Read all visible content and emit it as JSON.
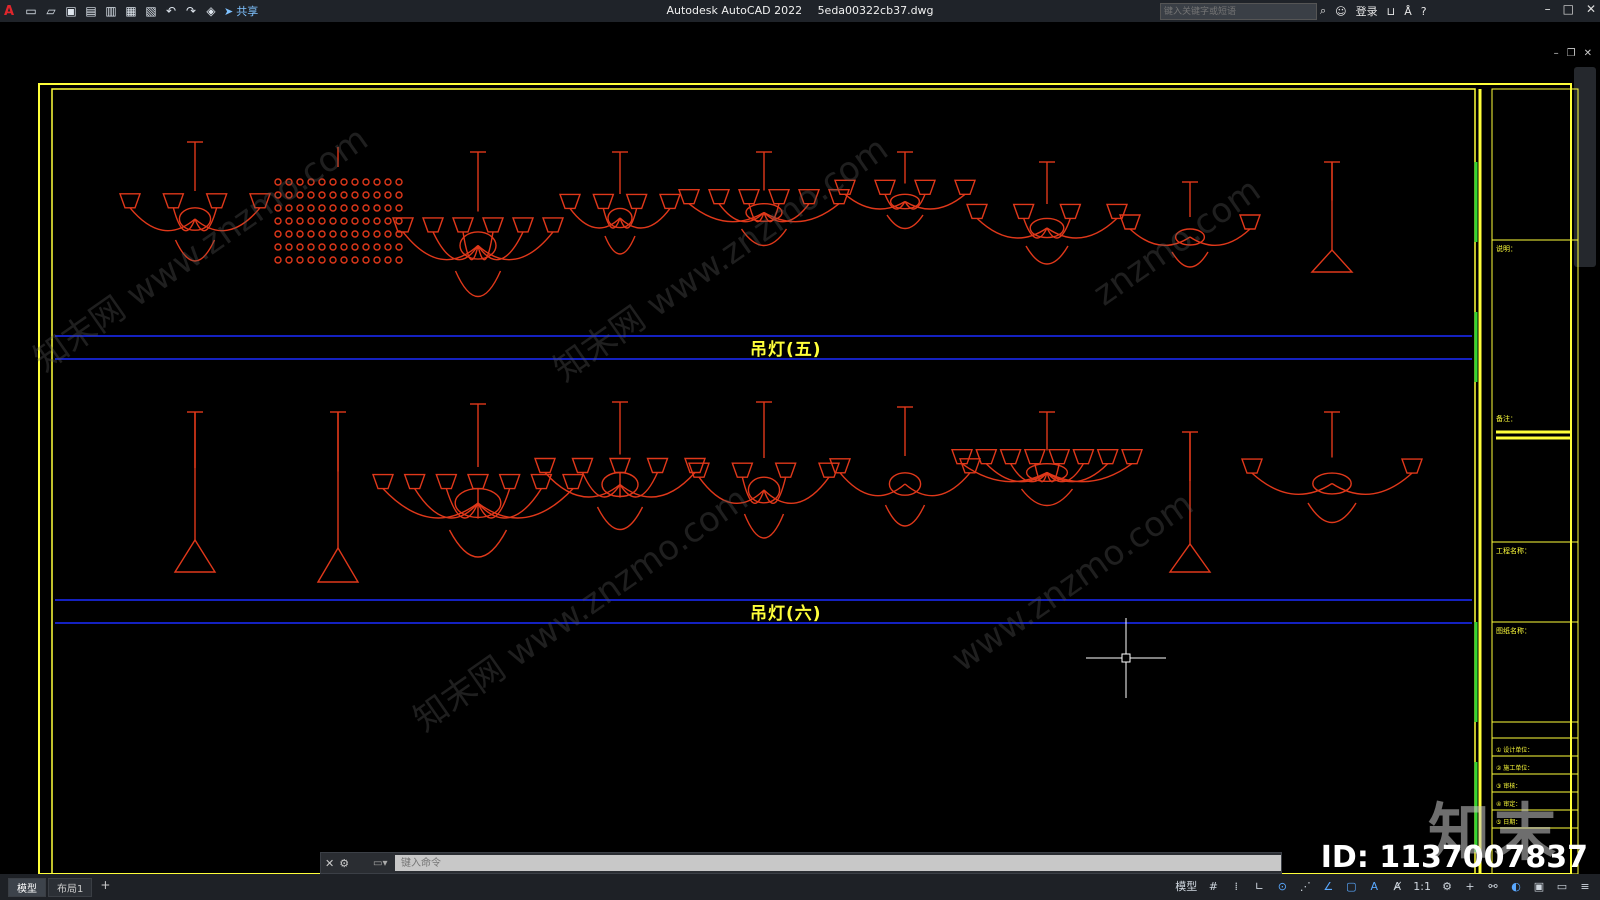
{
  "app": {
    "title": "Autodesk AutoCAD 2022",
    "filename": "5eda00322cb37.dwg",
    "logo": "A"
  },
  "quick_access": {
    "share_label": "共享",
    "icons": [
      "new-icon",
      "open-icon",
      "save-icon",
      "saveas-icon",
      "open-web-icon",
      "save-web-icon",
      "plot-icon",
      "undo-icon",
      "redo-icon",
      "workspace-icon",
      "share-icon"
    ]
  },
  "search": {
    "placeholder": "键入关键字或短语"
  },
  "account": {
    "login_label": "登录"
  },
  "drawing": {
    "row1_title": "吊灯(五)",
    "row2_title": "吊灯(六)",
    "colors": {
      "fixtures": "#e0381a",
      "frame": "#ffff3a",
      "band": "#1a2cff",
      "titleblock_text": "#ffff3a",
      "crosshair": "#ffffff",
      "green_ticks": "#33d633"
    }
  },
  "title_block": {
    "notes_heading": "说明：",
    "section2": "备注：",
    "project_label": "工程名称：",
    "drawing_label": "图纸名称：",
    "rows": [
      "① 设计单位：",
      "② 施工单位：",
      "③ 审核：",
      "④ 审定：",
      "⑤ 日期："
    ]
  },
  "watermarks": {
    "brand": "知末",
    "id_text": "ID: 1137007837",
    "repeat": [
      "知末网 www.znzmo.com",
      "知末网 www.znzmo.com",
      "znzmo.com",
      "知末网 www.znzmo.com",
      "www.znzmo.com"
    ]
  },
  "command": {
    "placeholder": "键入命令"
  },
  "layout_tabs": {
    "tabs": [
      "模型",
      "布局1"
    ],
    "active": "模型",
    "add_label": "+"
  },
  "statusbar": {
    "model_label": "模型",
    "scale_label": "1:1"
  }
}
